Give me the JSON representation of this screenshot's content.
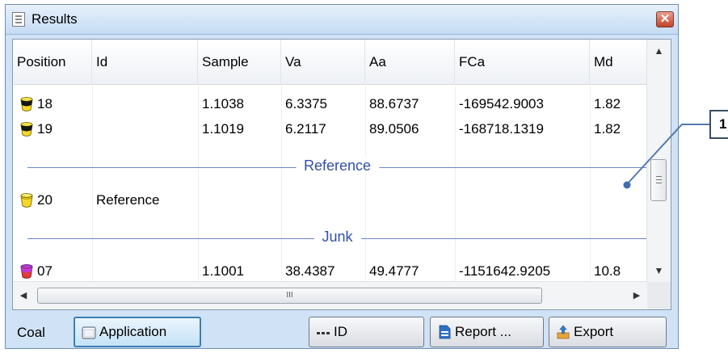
{
  "window": {
    "title": "Results"
  },
  "grid": {
    "columns": [
      "Position",
      "Id",
      "Sample",
      "Va",
      "Aa",
      "FCa",
      "Md"
    ],
    "rows": [
      {
        "position": "18",
        "id": "",
        "sample": "1.1038",
        "va": "6.3375",
        "aa": "88.6737",
        "fca": "-169542.9003",
        "md": "1.82",
        "pot": "black-yellow-crucible-icon"
      },
      {
        "position": "19",
        "id": "",
        "sample": "1.1019",
        "va": "6.2117",
        "aa": "89.0506",
        "fca": "-168718.1319",
        "md": "1.82",
        "pot": "black-yellow-crucible-icon"
      }
    ],
    "group_reference": "Reference",
    "reference_row": {
      "position": "20",
      "id": "Reference",
      "pot": "yellow-crucible-icon"
    },
    "group_junk": "Junk",
    "junk_row": {
      "position": "07",
      "id": "",
      "sample": "1.1001",
      "va": "38.4387",
      "aa": "49.4777",
      "fca": "-1151642.9205",
      "md": "10.8",
      "pot": "red-crucible-icon"
    },
    "hscroll_grip": "III"
  },
  "footer": {
    "label": "Coal",
    "application_button": "Application",
    "id_button": "ID",
    "report_button": "Report ...",
    "export_button": "Export"
  },
  "callout": {
    "number": "1"
  },
  "colors": {
    "group_text": "#3050a8",
    "accent": "#3c7fb1"
  }
}
